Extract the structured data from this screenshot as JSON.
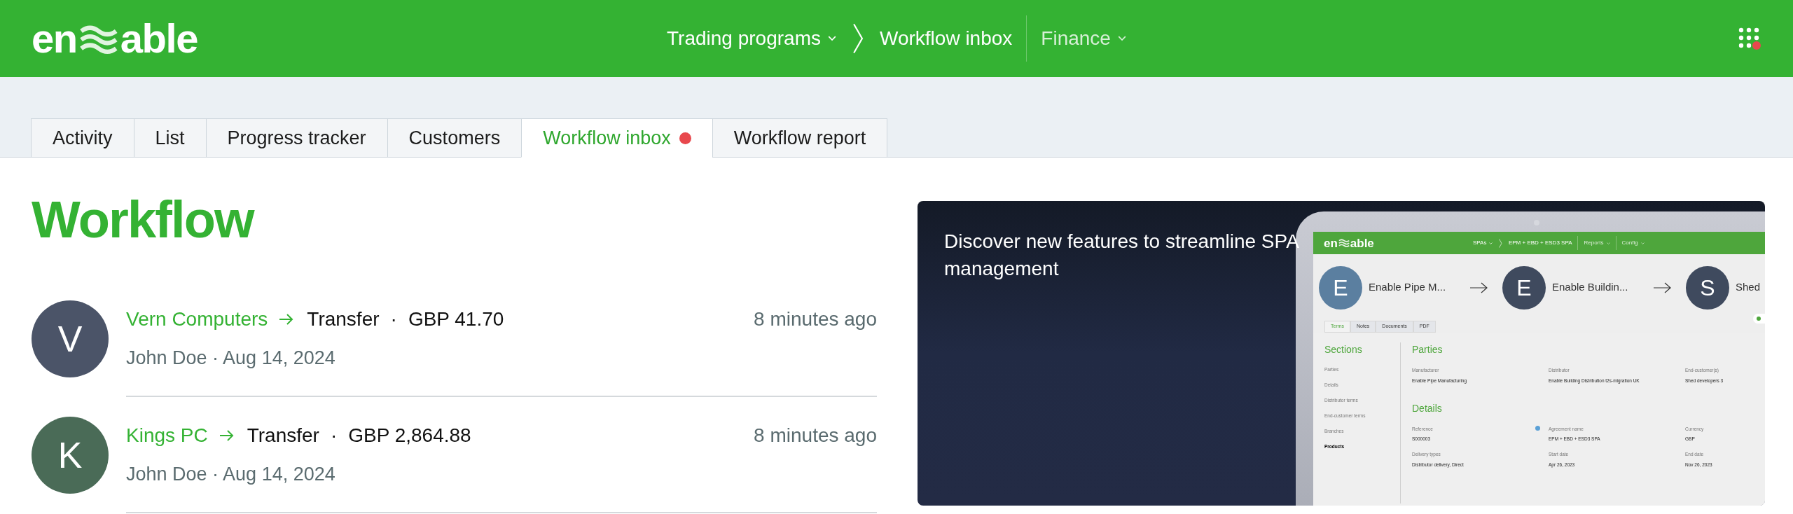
{
  "header": {
    "logo": {
      "left": "en",
      "right": "able"
    },
    "breadcrumb": [
      {
        "label": "Trading programs",
        "dropdown": true
      },
      {
        "label": "Workflow inbox",
        "dropdown": false
      }
    ],
    "menus": [
      {
        "label": "Finance",
        "dropdown": true
      }
    ],
    "apps_notification": true
  },
  "tabs": [
    {
      "label": "Activity",
      "selected": false,
      "notification": false
    },
    {
      "label": "List",
      "selected": false,
      "notification": false
    },
    {
      "label": "Progress tracker",
      "selected": false,
      "notification": false
    },
    {
      "label": "Customers",
      "selected": false,
      "notification": false
    },
    {
      "label": "Workflow inbox",
      "selected": true,
      "notification": true
    },
    {
      "label": "Workflow report",
      "selected": false,
      "notification": false
    }
  ],
  "heading": "Workflow",
  "items": [
    {
      "initial": "V",
      "color": "#4b5468",
      "customer": "Vern Computers",
      "action": "Transfer",
      "separator": "·",
      "amount": "GBP 41.70",
      "author": "John Doe · Aug 14, 2024",
      "time": "8 minutes ago"
    },
    {
      "initial": "K",
      "color": "#4a6b57",
      "customer": "Kings PC",
      "action": "Transfer",
      "separator": "·",
      "amount": "GBP 2,864.88",
      "author": "John Doe · Aug 14, 2024",
      "time": "8 minutes ago"
    }
  ],
  "promo": {
    "title": "Discover new features to streamline SPA management",
    "preview": {
      "logo": {
        "left": "en",
        "right": "able"
      },
      "breadcrumb": [
        {
          "label": "SPAs",
          "dropdown": true
        },
        {
          "label": "EPM + EBD + ESD3 SPA",
          "dropdown": false
        }
      ],
      "menus": [
        {
          "label": "Reports",
          "dropdown": true
        },
        {
          "label": "Config",
          "dropdown": true
        }
      ],
      "parties": [
        {
          "initial": "E",
          "color": "#5b7fa0",
          "name": "Enable Pipe M..."
        },
        {
          "initial": "E",
          "color": "#3f4a5e",
          "name": "Enable Buildin..."
        },
        {
          "initial": "S",
          "color": "#3f4a5e",
          "name": "Shed"
        }
      ],
      "tabs": [
        {
          "label": "Terms",
          "selected": true
        },
        {
          "label": "Notes",
          "selected": false
        },
        {
          "label": "Documents",
          "selected": false
        },
        {
          "label": "PDF",
          "selected": false
        }
      ],
      "sections_title": "Sections",
      "sections": [
        {
          "label": "Parties",
          "selected": false
        },
        {
          "label": "Details",
          "selected": false
        },
        {
          "label": "Distributor terms",
          "selected": false
        },
        {
          "label": "End-customer terms",
          "selected": false
        },
        {
          "label": "Branches",
          "selected": false
        },
        {
          "label": "Products",
          "selected": true
        }
      ],
      "groups": [
        {
          "title": "Parties",
          "fields": [
            {
              "label": "Manufacturer",
              "value": "Enable Pipe Manufacturing",
              "help": false
            },
            {
              "label": "Distributor",
              "value": "Enable Building Distribution t2s-migration UK",
              "help": false
            },
            {
              "label": "End-customer(s)",
              "value": "Shed developers 3",
              "help": false
            }
          ]
        },
        {
          "title": "Details",
          "fields": [
            {
              "label": "Reference",
              "value": "S000003",
              "help": true
            },
            {
              "label": "Agreement name",
              "value": "EPM + EBD + ESD3 SPA",
              "help": false
            },
            {
              "label": "Currency",
              "value": "GBP",
              "help": false
            },
            {
              "label": "Delivery types",
              "value": "Distributor delivery, Direct",
              "help": false
            },
            {
              "label": "Start date",
              "value": "Apr 26, 2023",
              "help": false
            },
            {
              "label": "End date",
              "value": "Nov 26, 2023",
              "help": false
            }
          ]
        }
      ]
    }
  }
}
